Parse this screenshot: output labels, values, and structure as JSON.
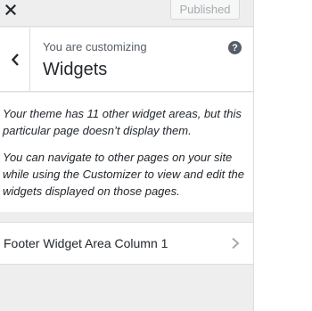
{
  "topbar": {
    "close_icon": "close-icon",
    "publish_label": "Published"
  },
  "header": {
    "customizing_label": "You are customizing",
    "title": "Widgets",
    "back_icon": "chevron-left-icon",
    "help_label": "?"
  },
  "description": {
    "paragraph1": "Your theme has 11 other widget areas, but this particular page doesn’t display them.",
    "paragraph2": "You can navigate to other pages on your site while using the Customizer to view and edit the widgets displayed on those pages."
  },
  "widget_areas": [
    {
      "label": "Footer Widget Area Column 1",
      "icon": "chevron-right-icon"
    }
  ],
  "colors": {
    "panel_bg": "#eeeeee",
    "text": "#23282d",
    "muted": "#555d66",
    "disabled": "#a7aaad"
  }
}
